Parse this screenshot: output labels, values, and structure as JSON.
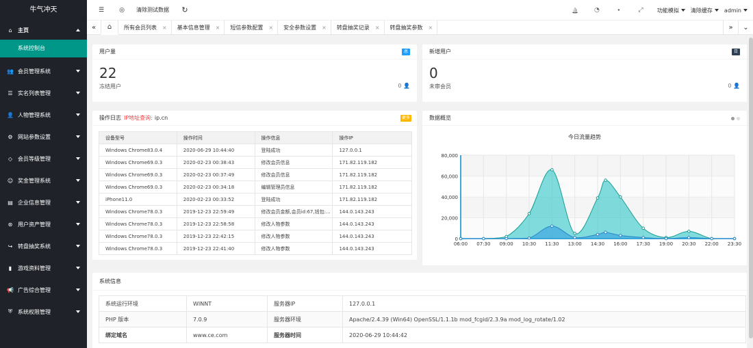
{
  "sidebar": {
    "logo": "牛气冲天",
    "home_label": "主页",
    "home_sub": "系统控制台",
    "items": [
      {
        "label": "会员管理系统",
        "icon": "users-icon",
        "glyph": "👥"
      },
      {
        "label": "实名列表管理",
        "icon": "list-icon",
        "glyph": "☰"
      },
      {
        "label": "人物管理系统",
        "icon": "user-icon",
        "glyph": "👤"
      },
      {
        "label": "网站参数设置",
        "icon": "gear-icon",
        "glyph": "⚙"
      },
      {
        "label": "会员等级管理",
        "icon": "diamond-icon",
        "glyph": "◇"
      },
      {
        "label": "奖金管理系统",
        "icon": "smile-icon",
        "glyph": "☺"
      },
      {
        "label": "企业信息管理",
        "icon": "file-icon",
        "glyph": "▤"
      },
      {
        "label": "用户资产管理",
        "icon": "asset-icon",
        "glyph": "⊛"
      },
      {
        "label": "转盘抽奖系统",
        "icon": "share-icon",
        "glyph": "↪"
      },
      {
        "label": "游戏资料管理",
        "icon": "game-icon",
        "glyph": "▮"
      },
      {
        "label": "广告综合管理",
        "icon": "megaphone-icon",
        "glyph": "📢"
      },
      {
        "label": "系统权限管理",
        "icon": "shield-icon",
        "glyph": "⛨"
      }
    ]
  },
  "header": {
    "menu_icon": "☰",
    "site_icon": "◎",
    "clear_test_data": "清除测试数据",
    "refresh_icon": "↻",
    "bell_icon": "🔔",
    "theme_icon": "◔",
    "tag_icon": "⬩",
    "fullscreen_icon": "⤢",
    "dropdown1": "功能模拟",
    "dropdown2": "清除缓存",
    "user": "admin"
  },
  "tabs": {
    "prev": "«",
    "next": "»",
    "menu": "⌄",
    "home_icon": "⌂",
    "items": [
      "所有会员列表",
      "基本信息管理",
      "短信参数配置",
      "安全参数设置",
      "转盘抽奖记录",
      "转盘抽奖参数"
    ]
  },
  "cards": {
    "users": {
      "title": "用户量",
      "badge": "总",
      "badge_color": "#1e9fff",
      "value": "22",
      "sub_label": "冻结用户",
      "sub_value": "0"
    },
    "new_users": {
      "title": "新增用户",
      "badge": "日",
      "badge_color": "#2f4056",
      "value": "0",
      "sub_label": "未审会员",
      "sub_value": "0"
    }
  },
  "log": {
    "title": "操作日志",
    "ip_query": "IP地址查询:",
    "ip_site": "ip.cn",
    "more": "更多",
    "headers": [
      "设备型号",
      "操作时间",
      "操作信息",
      "操作IP"
    ],
    "rows": [
      [
        "Windows Chrome83.0.4",
        "2020-06-29 10:44:40",
        "登陆成功",
        "127.0.0.1"
      ],
      [
        "Windows Chrome69.0.3",
        "2020-02-23 00:38:43",
        "修改会员信息",
        "171.82.119.182"
      ],
      [
        "Windows Chrome69.0.3",
        "2020-02-23 00:37:49",
        "修改会员信息",
        "171.82.119.182"
      ],
      [
        "Windows Chrome69.0.3",
        "2020-02-23 00:34:18",
        "编辑管理员信息",
        "171.82.119.182"
      ],
      [
        "iPhone11.0",
        "2020-02-23 00:33:52",
        "登陆成功",
        "171.82.119.182"
      ],
      [
        "Windows Chrome78.0.3",
        "2019-12-23 22:59:49",
        "修改会员金额,会员id:67,钱包:...",
        "144.0.143.243"
      ],
      [
        "Windows Chrome78.0.3",
        "2019-12-23 22:58:58",
        "修改人物参数",
        "144.0.143.243"
      ],
      [
        "Windows Chrome78.0.3",
        "2019-12-23 22:42:15",
        "修改人物参数",
        "144.0.143.243"
      ],
      [
        "Windows Chrome78.0.3",
        "2019-12-23 22:41:40",
        "修改人物参数",
        "144.0.143.243"
      ]
    ]
  },
  "overview": {
    "title": "数据概览"
  },
  "chart_data": {
    "type": "area",
    "title": "今日流量趋势",
    "x": [
      "06:00",
      "07:30",
      "09:00",
      "10:30",
      "11:30",
      "13:00",
      "14:30",
      "15:00",
      "16:00",
      "17:30",
      "19:00",
      "20:30",
      "22:00",
      "23:30"
    ],
    "x_ticks": [
      "06:00",
      "07:30",
      "09:00",
      "10:30",
      "11:30",
      "13:00",
      "14:30",
      "16:00",
      "17:30",
      "19:00",
      "20:30",
      "22:00",
      "23:30"
    ],
    "ylim": [
      0,
      80000
    ],
    "y_ticks": [
      "0",
      "20,000",
      "40,000",
      "60,000",
      "80,000"
    ],
    "series": [
      {
        "color": "#2ec7c9",
        "values": [
          0,
          0,
          2000,
          24000,
          66000,
          5000,
          39000,
          56000,
          40000,
          10000,
          1000,
          7000,
          0,
          0
        ]
      },
      {
        "color": "#2f99e0",
        "values": [
          0,
          0,
          0,
          500,
          12000,
          1000,
          4000,
          6000,
          3000,
          1000,
          0,
          1000,
          0,
          0
        ]
      }
    ]
  },
  "sysinfo": {
    "title": "系统信息",
    "rows": [
      [
        "系统运行环境",
        "WINNT",
        "服务器IP",
        "127.0.0.1"
      ],
      [
        "PHP 版本",
        "7.0.9",
        "服务器环境",
        "Apache/2.4.39 (Win64) OpenSSL/1.1.1b mod_fcgid/2.3.9a mod_log_rotate/1.02"
      ],
      [
        "绑定域名",
        "www.ce.com",
        "服务器时间",
        "2020-06-29 10:44:42"
      ]
    ]
  }
}
